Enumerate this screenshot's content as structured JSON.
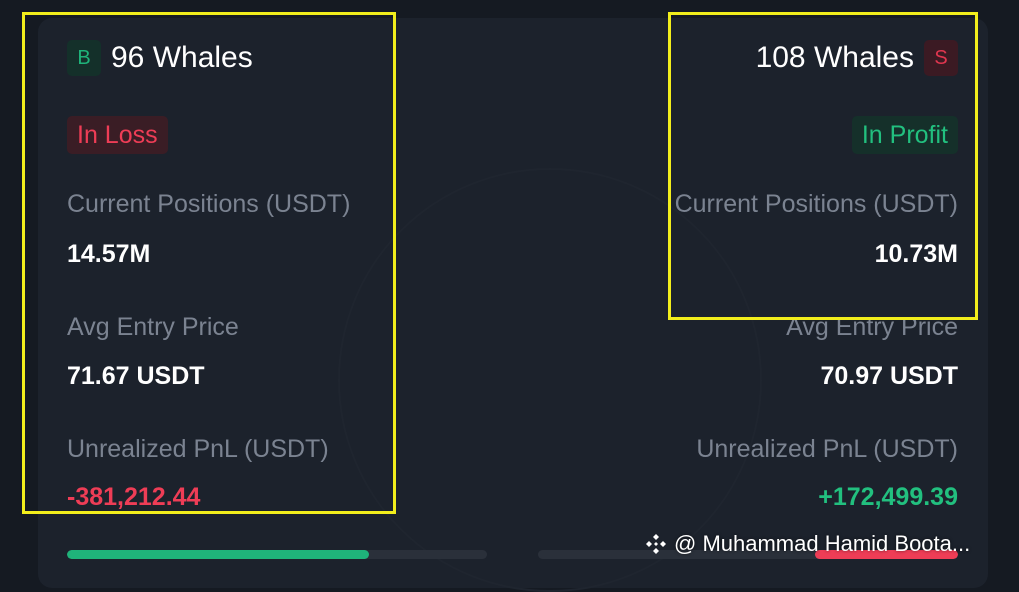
{
  "buy_side": {
    "badge": "B",
    "whales": "96 Whales",
    "status": "In Loss",
    "positions_label": "Current Positions (USDT)",
    "positions_value": "14.57M",
    "entry_label": "Avg Entry Price",
    "entry_value": "71.67 USDT",
    "pnl_label": "Unrealized PnL (USDT)",
    "pnl_value": "-381,212.44"
  },
  "sell_side": {
    "badge": "S",
    "whales": "108 Whales",
    "status": "In Profit",
    "positions_label": "Current Positions (USDT)",
    "positions_value": "10.73M",
    "entry_label": "Avg Entry Price",
    "entry_value": "70.97 USDT",
    "pnl_label": "Unrealized PnL (USDT)",
    "pnl_value": "+172,499.39"
  },
  "progress": {
    "buy_fraction": 0.72,
    "sell_fraction": 0.34
  },
  "watermark": {
    "text": "@ Muhammad Hamid Boota..."
  },
  "colors": {
    "profit": "#22c07f",
    "loss": "#ee3d56",
    "highlight": "#f2ee1c"
  }
}
